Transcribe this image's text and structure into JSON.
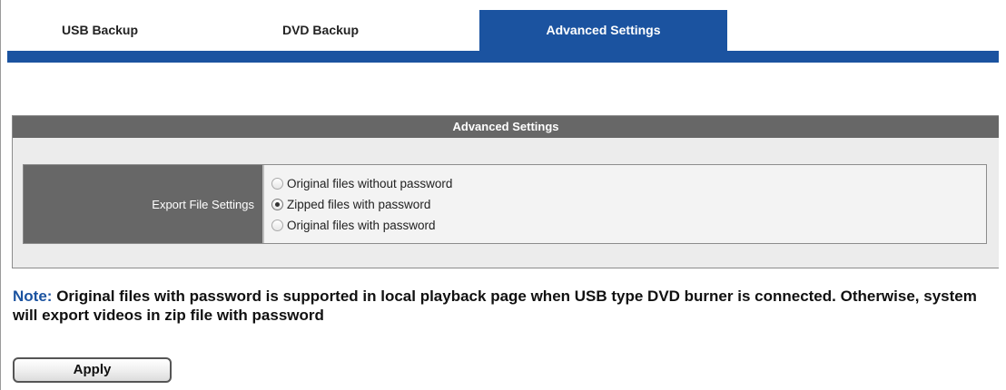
{
  "tabs": [
    {
      "label": "USB Backup",
      "active": false
    },
    {
      "label": "DVD Backup",
      "active": false
    },
    {
      "label": "Advanced Settings",
      "active": true
    }
  ],
  "panel": {
    "title": "Advanced Settings",
    "export_file_settings": {
      "label": "Export File Settings",
      "options": [
        {
          "label": "Original files without password",
          "checked": false
        },
        {
          "label": "Zipped files with password",
          "checked": true
        },
        {
          "label": "Original files with password",
          "checked": false
        }
      ]
    }
  },
  "note": {
    "prefix": "Note:",
    "text": "Original files with password is supported in local playback page when USB type DVD burner is connected. Otherwise, system will export videos in zip file with password"
  },
  "apply_button": {
    "label": "Apply"
  },
  "colors": {
    "accent": "#1b53a0",
    "header_bg": "#676767",
    "panel_bg": "#ececec"
  }
}
